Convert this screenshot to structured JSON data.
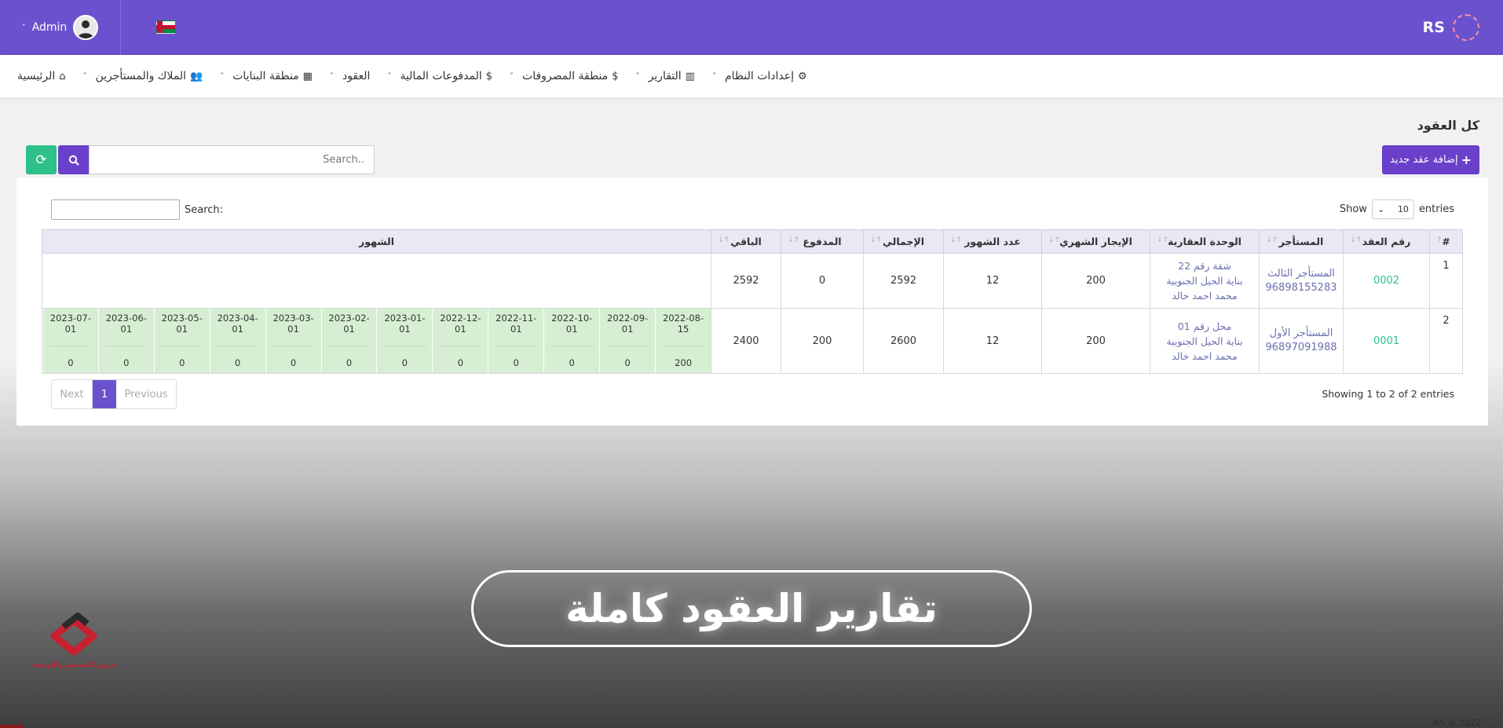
{
  "topbar": {
    "brand": "RS",
    "user_name": "Admin",
    "chevron": "˅"
  },
  "nav": {
    "items": [
      {
        "label": "الرئيسية",
        "icon": "home-icon",
        "glyph": "⌂"
      },
      {
        "label": "الملاك والمستأجرين",
        "icon": "users-icon",
        "glyph": "👥"
      },
      {
        "label": "منطقة البنايات",
        "icon": "building-icon",
        "glyph": "▦"
      },
      {
        "label": "العقود",
        "icon": "",
        "glyph": ""
      },
      {
        "label": "المدفوعات المالية",
        "icon": "dollar-icon",
        "glyph": "$"
      },
      {
        "label": "منطقة المصروفات",
        "icon": "dollar-icon",
        "glyph": "$"
      },
      {
        "label": "التقارير",
        "icon": "chart-icon",
        "glyph": "▥"
      },
      {
        "label": "إعدادات النظام",
        "icon": "gear-icon",
        "glyph": "⚙"
      }
    ]
  },
  "page": {
    "title": "كل العقود",
    "add_button": "إضافة عقد جديد",
    "search_placeholder": "Search.."
  },
  "datatable": {
    "show_label": "Show",
    "entries_value": "10",
    "entries_label": "entries",
    "search_label": "Search:",
    "columns": [
      "#",
      "رقم العقد",
      "المستأجر",
      "الوحدة العقارية",
      "الإيجار الشهري",
      "عدد الشهور",
      "الإجمالي",
      "المدفوع",
      "الباقي",
      "الشهور"
    ],
    "rows": [
      {
        "index": "1",
        "contract": "0002",
        "tenant_name": "المستأجر الثالث",
        "tenant_phone": "96898155283",
        "unit_1": "شقة رقم 22",
        "unit_2": "بناية الحيل الجنوبية",
        "unit_3": "محمد احمد خالد",
        "rent": "200",
        "months_count": "12",
        "total": "2592",
        "paid": "0",
        "remaining": "2592"
      },
      {
        "index": "2",
        "contract": "0001",
        "tenant_name": "المستأجر الأول",
        "tenant_phone": "96897091988",
        "unit_1": "محل رقم 01",
        "unit_2": "بناية الحيل الجنوبية",
        "unit_3": "محمد احمد خالد",
        "rent": "200",
        "months_count": "12",
        "total": "2600",
        "paid": "200",
        "remaining": "2400",
        "months": [
          {
            "date": "2022-08-15",
            "value": "200"
          },
          {
            "date": "2022-09-01",
            "value": "0"
          },
          {
            "date": "2022-10-01",
            "value": "0"
          },
          {
            "date": "2022-11-01",
            "value": "0"
          },
          {
            "date": "2022-12-01",
            "value": "0"
          },
          {
            "date": "2023-01-01",
            "value": "0"
          },
          {
            "date": "2023-02-01",
            "value": "0"
          },
          {
            "date": "2023-03-01",
            "value": "0"
          },
          {
            "date": "2023-04-01",
            "value": "0"
          },
          {
            "date": "2023-05-01",
            "value": "0"
          },
          {
            "date": "2023-06-01",
            "value": "0"
          },
          {
            "date": "2023-07-01",
            "value": "0"
          }
        ]
      }
    ],
    "info": "Showing 1 to 2 of 2 entries",
    "pager": {
      "next": "Next",
      "current": "1",
      "previous": "Previous"
    }
  },
  "overlay": {
    "banner": "تقارير العقود كاملة",
    "logo_text": "مزون للتصميم والبرمجة",
    "copyright": "RS © 2022"
  },
  "colors": {
    "primary": "#6a52cf",
    "accent_button": "#6a3fc9",
    "success": "#2ec08a",
    "month_cell": "#d6efd3"
  }
}
